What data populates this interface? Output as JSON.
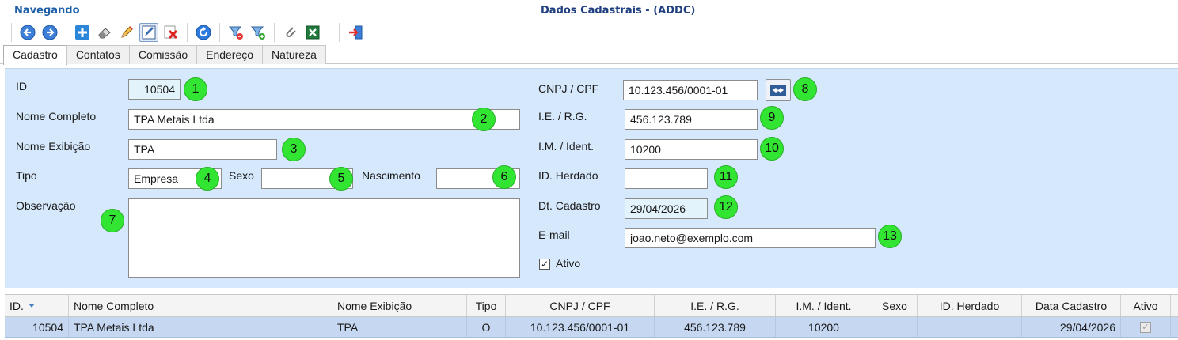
{
  "window": {
    "status": "Navegando",
    "title": "Dados Cadastrais - (ADDC)"
  },
  "toolbar": {
    "buttons": [
      {
        "icon": "arrow-left-icon"
      },
      {
        "icon": "arrow-right-icon"
      },
      {
        "icon": "plus-icon"
      },
      {
        "icon": "eraser-icon"
      },
      {
        "icon": "pencil-icon"
      },
      {
        "icon": "edit-checked-icon",
        "pressed": true
      },
      {
        "icon": "delete-icon"
      },
      {
        "icon": "refresh-icon"
      },
      {
        "icon": "filter-remove-icon"
      },
      {
        "icon": "filter-add-icon"
      },
      {
        "icon": "paperclip-icon"
      },
      {
        "icon": "excel-icon"
      },
      {
        "icon": "exit-icon"
      }
    ]
  },
  "tabs": [
    "Cadastro",
    "Contatos",
    "Comissão",
    "Endereço",
    "Natureza"
  ],
  "form": {
    "id": {
      "label": "ID",
      "value": "10504",
      "badge": "1"
    },
    "nome_completo": {
      "label": "Nome Completo",
      "value": "TPA Metais Ltda",
      "badge": "2"
    },
    "nome_exibicao": {
      "label": "Nome Exibição",
      "value": "TPA",
      "badge": "3"
    },
    "tipo": {
      "label": "Tipo",
      "value": "Empresa",
      "badge": "4"
    },
    "sexo": {
      "label": "Sexo",
      "value": "",
      "badge": "5"
    },
    "nascimento": {
      "label": "Nascimento",
      "value": "",
      "badge": "6"
    },
    "observacao": {
      "label": "Observação",
      "value": "",
      "badge": "7"
    },
    "cnpj": {
      "label": "CNPJ / CPF",
      "value": "10.123.456/0001-01",
      "badge": "8"
    },
    "ie": {
      "label": "I.E. / R.G.",
      "value": "456.123.789",
      "badge": "9"
    },
    "im": {
      "label": "I.M. / Ident.",
      "value": "10200",
      "badge": "10"
    },
    "id_herdado": {
      "label": "ID. Herdado",
      "value": "",
      "badge": "11"
    },
    "dt_cadastro": {
      "label": "Dt. Cadastro",
      "value": "29/04/2026",
      "badge": "12"
    },
    "email": {
      "label": "E-mail",
      "value": "joao.neto@exemplo.com",
      "badge": "13"
    },
    "ativo": {
      "label": "Ativo",
      "checked": true,
      "mark": "✓"
    }
  },
  "grid": {
    "columns": [
      "ID.",
      "Nome Completo",
      "Nome Exibição",
      "Tipo",
      "CNPJ / CPF",
      "I.E. / R.G.",
      "I.M. / Ident.",
      "Sexo",
      "ID. Herdado",
      "Data Cadastro",
      "Ativo"
    ],
    "rows": [
      [
        "10504",
        "TPA Metais Ltda",
        "TPA",
        "O",
        "10.123.456/0001-01",
        "456.123.789",
        "10200",
        "",
        "",
        "29/04/2026",
        "✓"
      ]
    ]
  },
  "colors": {
    "status_text": "#1f5fa8",
    "form_bg": "#d6e8fb",
    "badge": "#33e533",
    "row_selected": "#c5d7f1"
  }
}
